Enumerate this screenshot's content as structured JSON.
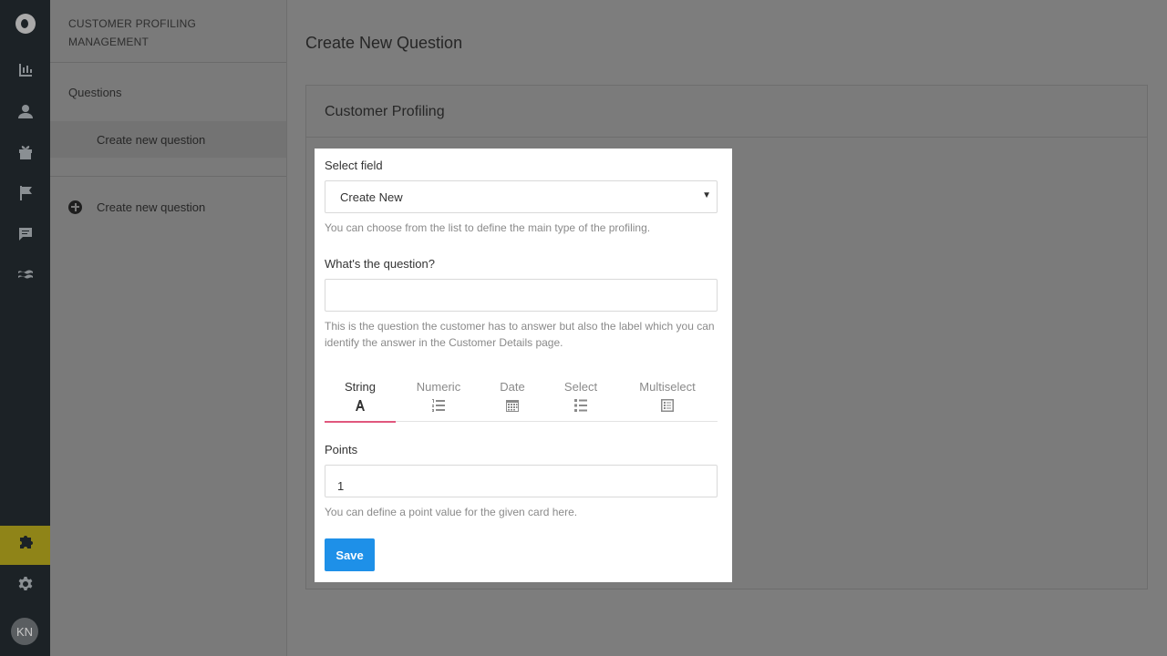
{
  "rail": {
    "avatar_initials": "KN",
    "icons": [
      "logo-icon",
      "dashboard-icon",
      "customers-icon",
      "gift-icon",
      "flag-icon",
      "message-icon",
      "waves-icon",
      "puzzle-icon",
      "gear-icon"
    ],
    "active_color": "#8f8418"
  },
  "sidebar": {
    "heading": "CUSTOMER PROFILING MANAGEMENT",
    "section": "Questions",
    "subitem": "Create new question",
    "create_action": "Create new question"
  },
  "main": {
    "page_title": "Create New Question",
    "card_title": "Customer Profiling"
  },
  "form": {
    "select_label": "Select field",
    "select_value": "Create New",
    "select_help": "You can choose from the list to define the main type of the profiling.",
    "question_label": "What's the question?",
    "question_value": "",
    "question_help": "This is the question the customer has to answer but also the label which you can identify the answer in the Customer Details page.",
    "tabs": [
      {
        "label": "String",
        "icon": "letter-a-icon",
        "active": true
      },
      {
        "label": "Numeric",
        "icon": "numbered-list-icon",
        "active": false
      },
      {
        "label": "Date",
        "icon": "calendar-icon",
        "active": false
      },
      {
        "label": "Select",
        "icon": "bullet-list-icon",
        "active": false
      },
      {
        "label": "Multiselect",
        "icon": "checklist-icon",
        "active": false
      }
    ],
    "points_label": "Points",
    "points_value": "1",
    "points_help": "You can define a point value for the given card here.",
    "save_label": "Save",
    "accent_color": "#1e90e8",
    "tab_indicator_color": "#e0577d"
  }
}
